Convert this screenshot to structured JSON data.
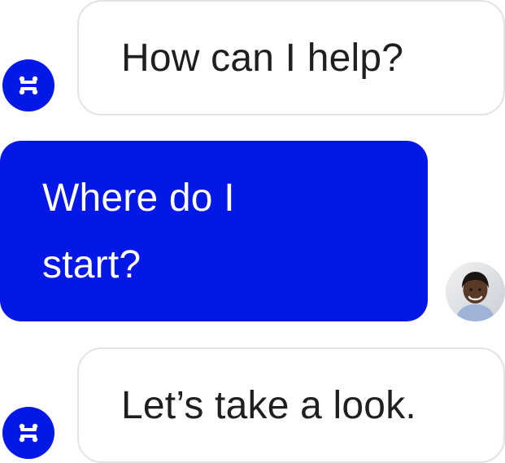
{
  "chat": {
    "messages": [
      {
        "role": "assistant",
        "text": "How can I help?"
      },
      {
        "role": "user",
        "text": "Where do I\nstart?"
      },
      {
        "role": "assistant",
        "text": "Let’s take a look."
      }
    ],
    "icons": {
      "assistant_avatar": "assistant-logo-icon",
      "user_avatar": "user-avatar-photo"
    },
    "colors": {
      "assistant_bubble_bg": "#ffffff",
      "assistant_bubble_border": "#e3e3e3",
      "user_bubble_bg": "#0317e6",
      "assistant_avatar_bg": "#0317e6",
      "text_dark": "#1f1f1f",
      "text_light": "#ffffff"
    }
  }
}
